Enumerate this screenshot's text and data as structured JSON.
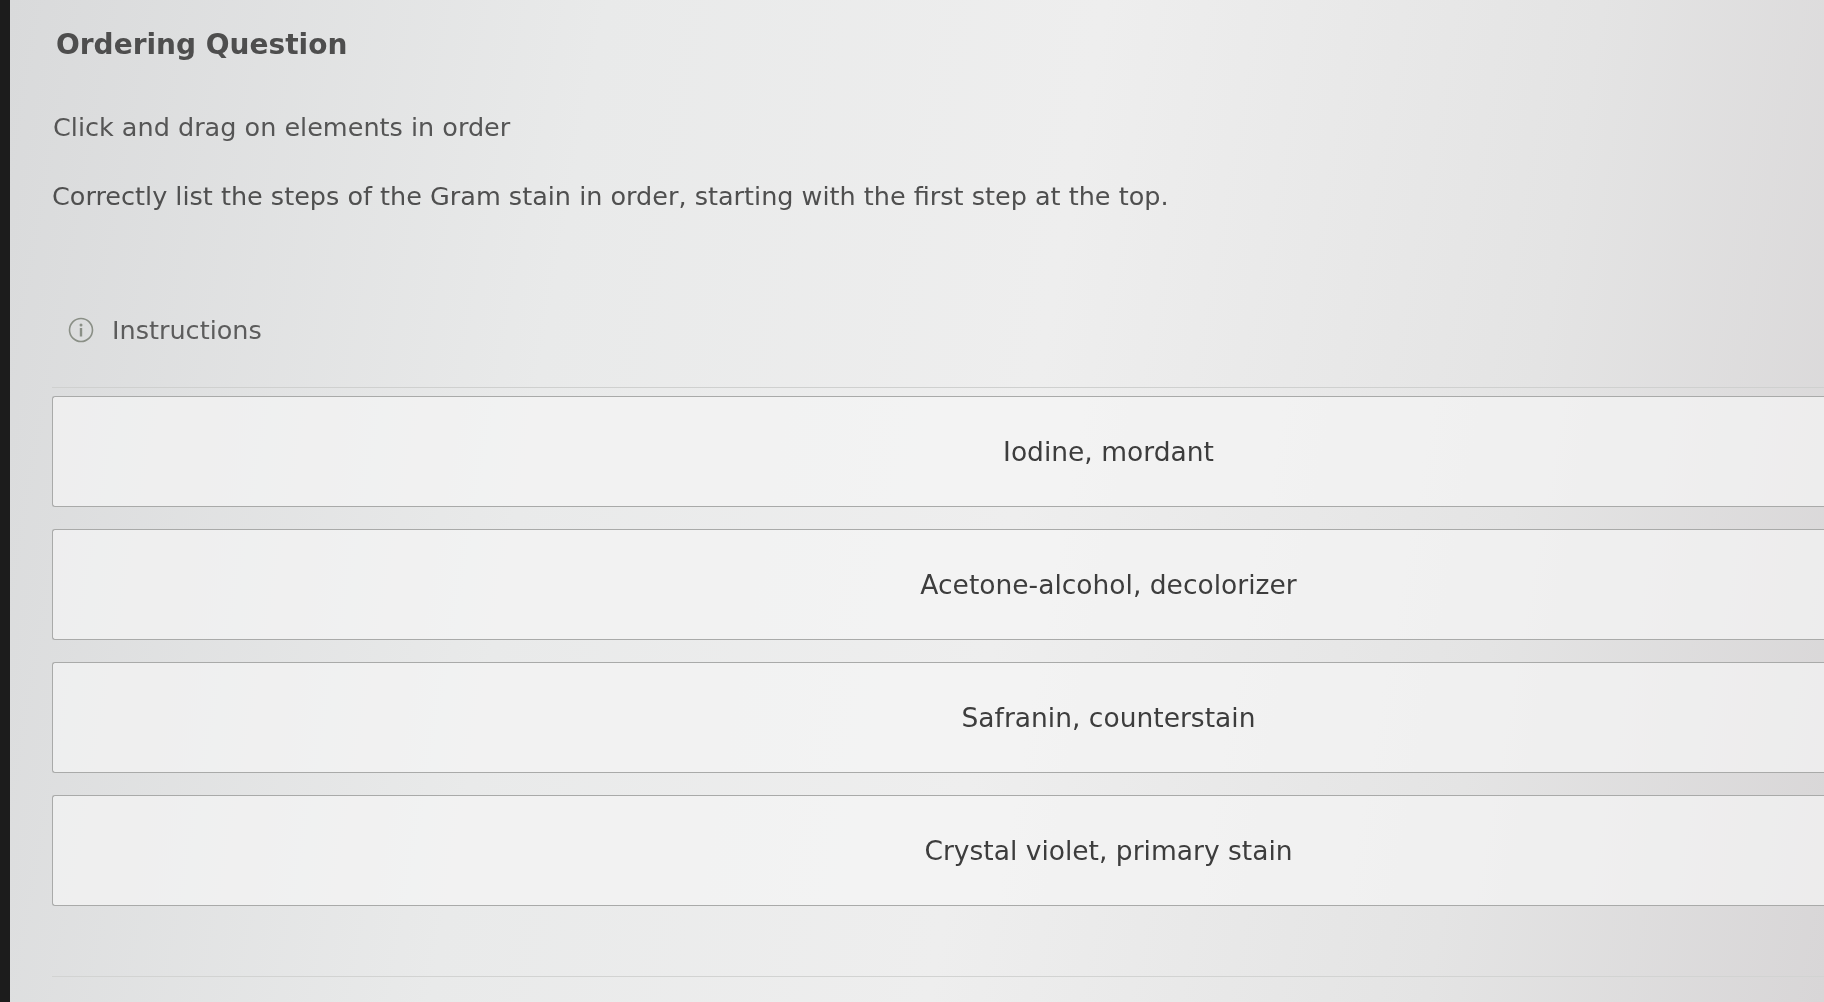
{
  "question": {
    "title": "Ordering Question",
    "prompt": "Click and drag on elements in order",
    "text": "Correctly list the steps of the Gram stain in order, starting with the first step at the top.",
    "instructions": {
      "label": "Instructions"
    }
  },
  "items": [
    {
      "label": "Iodine, mordant"
    },
    {
      "label": "Acetone-alcohol, decolorizer"
    },
    {
      "label": "Safranin, counterstain"
    },
    {
      "label": "Crystal violet, primary stain"
    }
  ]
}
